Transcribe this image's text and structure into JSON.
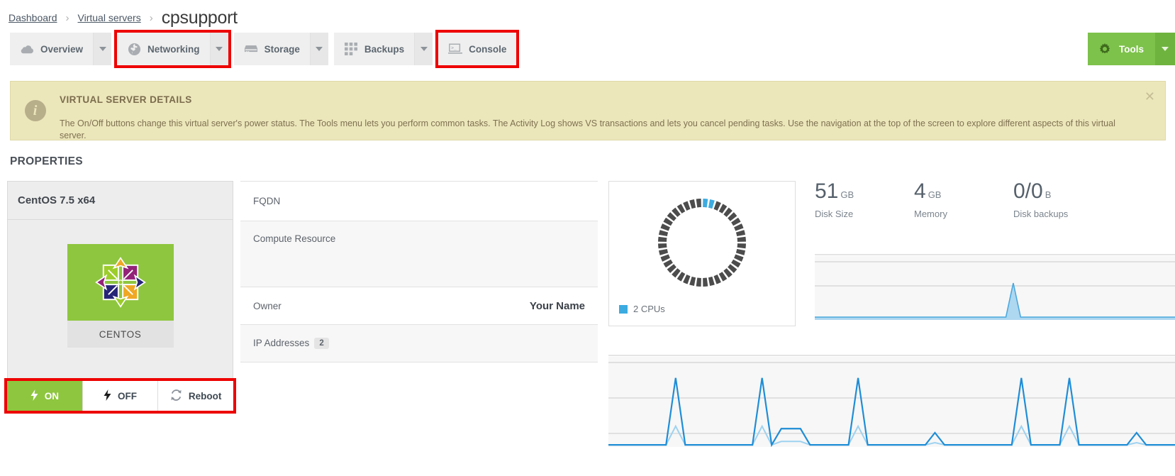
{
  "breadcrumb": {
    "items": [
      {
        "label": "Dashboard",
        "link": true
      },
      {
        "label": "Virtual servers",
        "link": true
      }
    ],
    "separator": "›",
    "current": "cpsupport"
  },
  "nav": {
    "items": [
      {
        "label": "Overview",
        "icon": "cloud-icon",
        "caret": true,
        "highlighted": false
      },
      {
        "label": "Networking",
        "icon": "globe-icon",
        "caret": true,
        "highlighted": true
      },
      {
        "label": "Storage",
        "icon": "disk-icon",
        "caret": true,
        "highlighted": false
      },
      {
        "label": "Backups",
        "icon": "grid-icon",
        "caret": true,
        "highlighted": false
      },
      {
        "label": "Console",
        "icon": "terminal-icon",
        "caret": false,
        "highlighted": true
      }
    ],
    "tools": {
      "label": "Tools",
      "icon": "gear-icon",
      "caret": true,
      "color": "#7dc24b"
    }
  },
  "alert": {
    "title": "VIRTUAL SERVER DETAILS",
    "text": "The On/Off buttons change this virtual server's power status. The Tools menu lets you perform common tasks. The Activity Log shows VS transactions and lets you cancel pending tasks. Use the navigation at the top of the screen to explore different aspects of this virtual server.",
    "icon": "info-icon",
    "close": "✕",
    "background": "#ece6bb"
  },
  "properties": {
    "heading": "PROPERTIES",
    "os_card": {
      "title": "CentOS 7.5 x64",
      "tile_label": "CENTOS",
      "tile_color": "#8ec63f",
      "logo": "centos-logo"
    },
    "power": {
      "on": {
        "label": "ON",
        "icon": "bolt-icon",
        "active": true
      },
      "off": {
        "label": "OFF",
        "icon": "bolt-icon",
        "active": false
      },
      "reboot": {
        "label": "Reboot",
        "icon": "refresh-icon",
        "active": false
      },
      "highlight_color": "#ee0000"
    },
    "details": [
      {
        "label": "FQDN",
        "value": ""
      },
      {
        "label": "Compute Resource",
        "value": ""
      },
      {
        "label": "Owner",
        "value": "Your Name"
      },
      {
        "label": "IP Addresses",
        "value": "",
        "badge": "2"
      }
    ]
  },
  "cpu_card": {
    "legend_label": "2 CPUs",
    "legend_color": "#3cabe0",
    "segment_color": "#4c4c4c"
  },
  "stats": [
    {
      "value": "51",
      "unit": "GB",
      "label": "Disk Size"
    },
    {
      "value": "4",
      "unit": "GB",
      "label": "Memory"
    },
    {
      "value": "0/0",
      "unit": "B",
      "label": "Disk backups"
    }
  ],
  "chart_data": [
    {
      "type": "area",
      "name": "bandwidth-sparkline",
      "title": "",
      "xlabel": "",
      "ylabel": "",
      "ylim": [
        0,
        100
      ],
      "grid": true,
      "line_color": "#4aa8de",
      "fill_color": "#aed7f0",
      "x": [
        0,
        1,
        2,
        3,
        4,
        5,
        6,
        7,
        8,
        9,
        10,
        11,
        12,
        13,
        14,
        15,
        16,
        17,
        18,
        19,
        20,
        21,
        22,
        23,
        24,
        25,
        26,
        27,
        28,
        29,
        30,
        31,
        32,
        33,
        34,
        35,
        36,
        37,
        38,
        39,
        40,
        41,
        42,
        43,
        44,
        45,
        46,
        47,
        48,
        49
      ],
      "values": [
        4,
        4,
        4,
        4,
        4,
        4,
        4,
        4,
        4,
        4,
        4,
        4,
        4,
        4,
        4,
        4,
        4,
        4,
        4,
        4,
        4,
        4,
        4,
        4,
        4,
        4,
        4,
        52,
        4,
        4,
        4,
        4,
        4,
        4,
        4,
        4,
        4,
        4,
        4,
        4,
        4,
        4,
        4,
        4,
        4,
        4,
        4,
        4,
        4,
        4
      ]
    },
    {
      "type": "line",
      "name": "cpu-usage-chart",
      "title": "",
      "xlabel": "",
      "ylabel": "",
      "ylim": [
        0,
        100
      ],
      "grid": true,
      "line_color": "#1f8dd6",
      "fill_color": "#cfe7f7",
      "x": [
        0,
        1,
        2,
        3,
        4,
        5,
        6,
        7,
        8,
        9,
        10,
        11,
        12,
        13,
        14,
        15,
        16,
        17,
        18,
        19,
        20,
        21,
        22,
        23,
        24,
        25,
        26,
        27,
        28,
        29,
        30,
        31,
        32,
        33,
        34,
        35,
        36,
        37,
        38,
        39,
        40,
        41,
        42,
        43,
        44,
        45,
        46,
        47,
        48,
        49,
        50,
        51,
        52,
        53,
        54,
        55,
        56,
        57,
        58,
        59
      ],
      "values": [
        2,
        2,
        2,
        2,
        2,
        2,
        2,
        68,
        2,
        2,
        2,
        2,
        2,
        2,
        2,
        2,
        68,
        2,
        18,
        18,
        18,
        2,
        2,
        2,
        2,
        2,
        68,
        2,
        2,
        2,
        2,
        2,
        2,
        2,
        14,
        2,
        2,
        2,
        2,
        2,
        2,
        2,
        2,
        68,
        2,
        2,
        2,
        2,
        68,
        2,
        2,
        2,
        2,
        2,
        2,
        14,
        2,
        2,
        2,
        2
      ]
    }
  ]
}
